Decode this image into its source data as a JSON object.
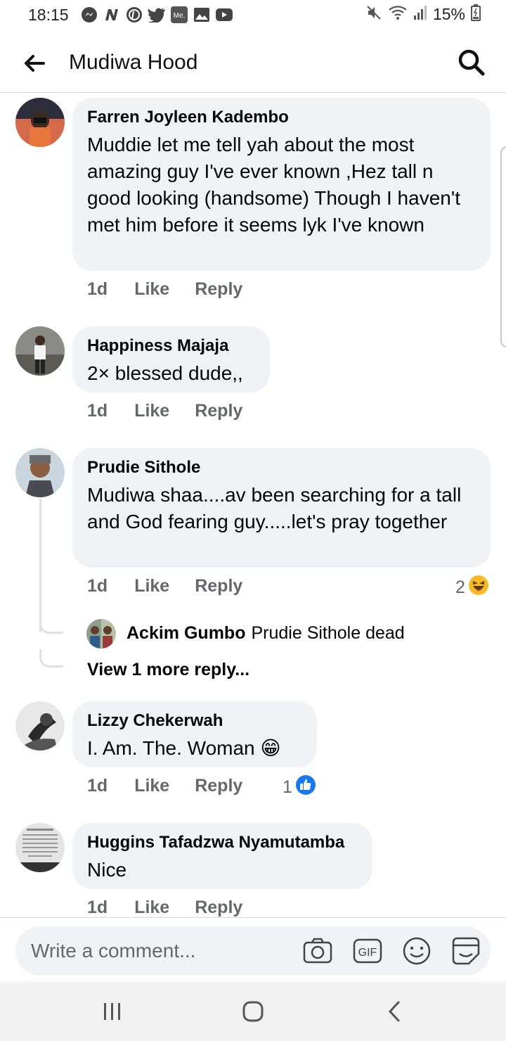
{
  "status_bar": {
    "time": "18:15",
    "battery": "15%",
    "left_icons": [
      "messenger-icon",
      "n-app-icon",
      "pinterest-icon",
      "twitter-icon",
      "me-app-icon",
      "gallery-icon",
      "youtube-icon"
    ],
    "me_icon_text": "Me.",
    "right_icons": [
      "mute-icon",
      "wifi-icon",
      "signal-icon",
      "battery-icon"
    ]
  },
  "header": {
    "title": "Mudiwa Hood",
    "back_icon": "back-arrow-icon",
    "search_icon": "search-icon"
  },
  "comments": [
    {
      "author": "Farren Joyleen Kadembo",
      "text": "Muddie let me tell yah about the most amazing guy I've ever known ,Hez tall n good looking (handsome) Though I haven't met him before it seems lyk I've known",
      "time": "1d",
      "like_label": "Like",
      "reply_label": "Reply"
    },
    {
      "author": "Happiness Majaja",
      "text": "2× blessed dude,,",
      "time": "1d",
      "like_label": "Like",
      "reply_label": "Reply"
    },
    {
      "author": "Prudie Sithole",
      "text": "Mudiwa shaa....av been searching for a tall and God fearing guy.....let's pray together",
      "time": "1d",
      "like_label": "Like",
      "reply_label": "Reply",
      "reaction_count": "2",
      "reaction_icon": "haha-emoji-icon",
      "reply": {
        "author": "Ackim Gumbo",
        "text": "Prudie Sithole dead"
      },
      "view_more": "View 1 more reply..."
    },
    {
      "author": "Lizzy Chekerwah",
      "text": "I. Am. The. Woman 😁",
      "time": "1d",
      "like_label": "Like",
      "reply_label": "Reply",
      "reaction_count": "1",
      "reaction_icon": "like-reaction-icon"
    },
    {
      "author": "Huggins Tafadzwa Nyamutamba",
      "text": "Nice",
      "time": "1d",
      "like_label": "Like",
      "reply_label": "Reply"
    }
  ],
  "composer": {
    "placeholder": "Write a comment...",
    "icons": [
      "camera-icon",
      "gif-icon",
      "emoji-icon",
      "sticker-icon"
    ],
    "gif_label": "GIF"
  },
  "nav_bar": {
    "icons": [
      "recent-apps-icon",
      "home-icon",
      "back-icon"
    ]
  },
  "colors": {
    "bubble": "#f0f2f5",
    "secondary_text": "#65676b",
    "like_blue": "#1877f2",
    "haha_yellow": "#f7b928"
  }
}
